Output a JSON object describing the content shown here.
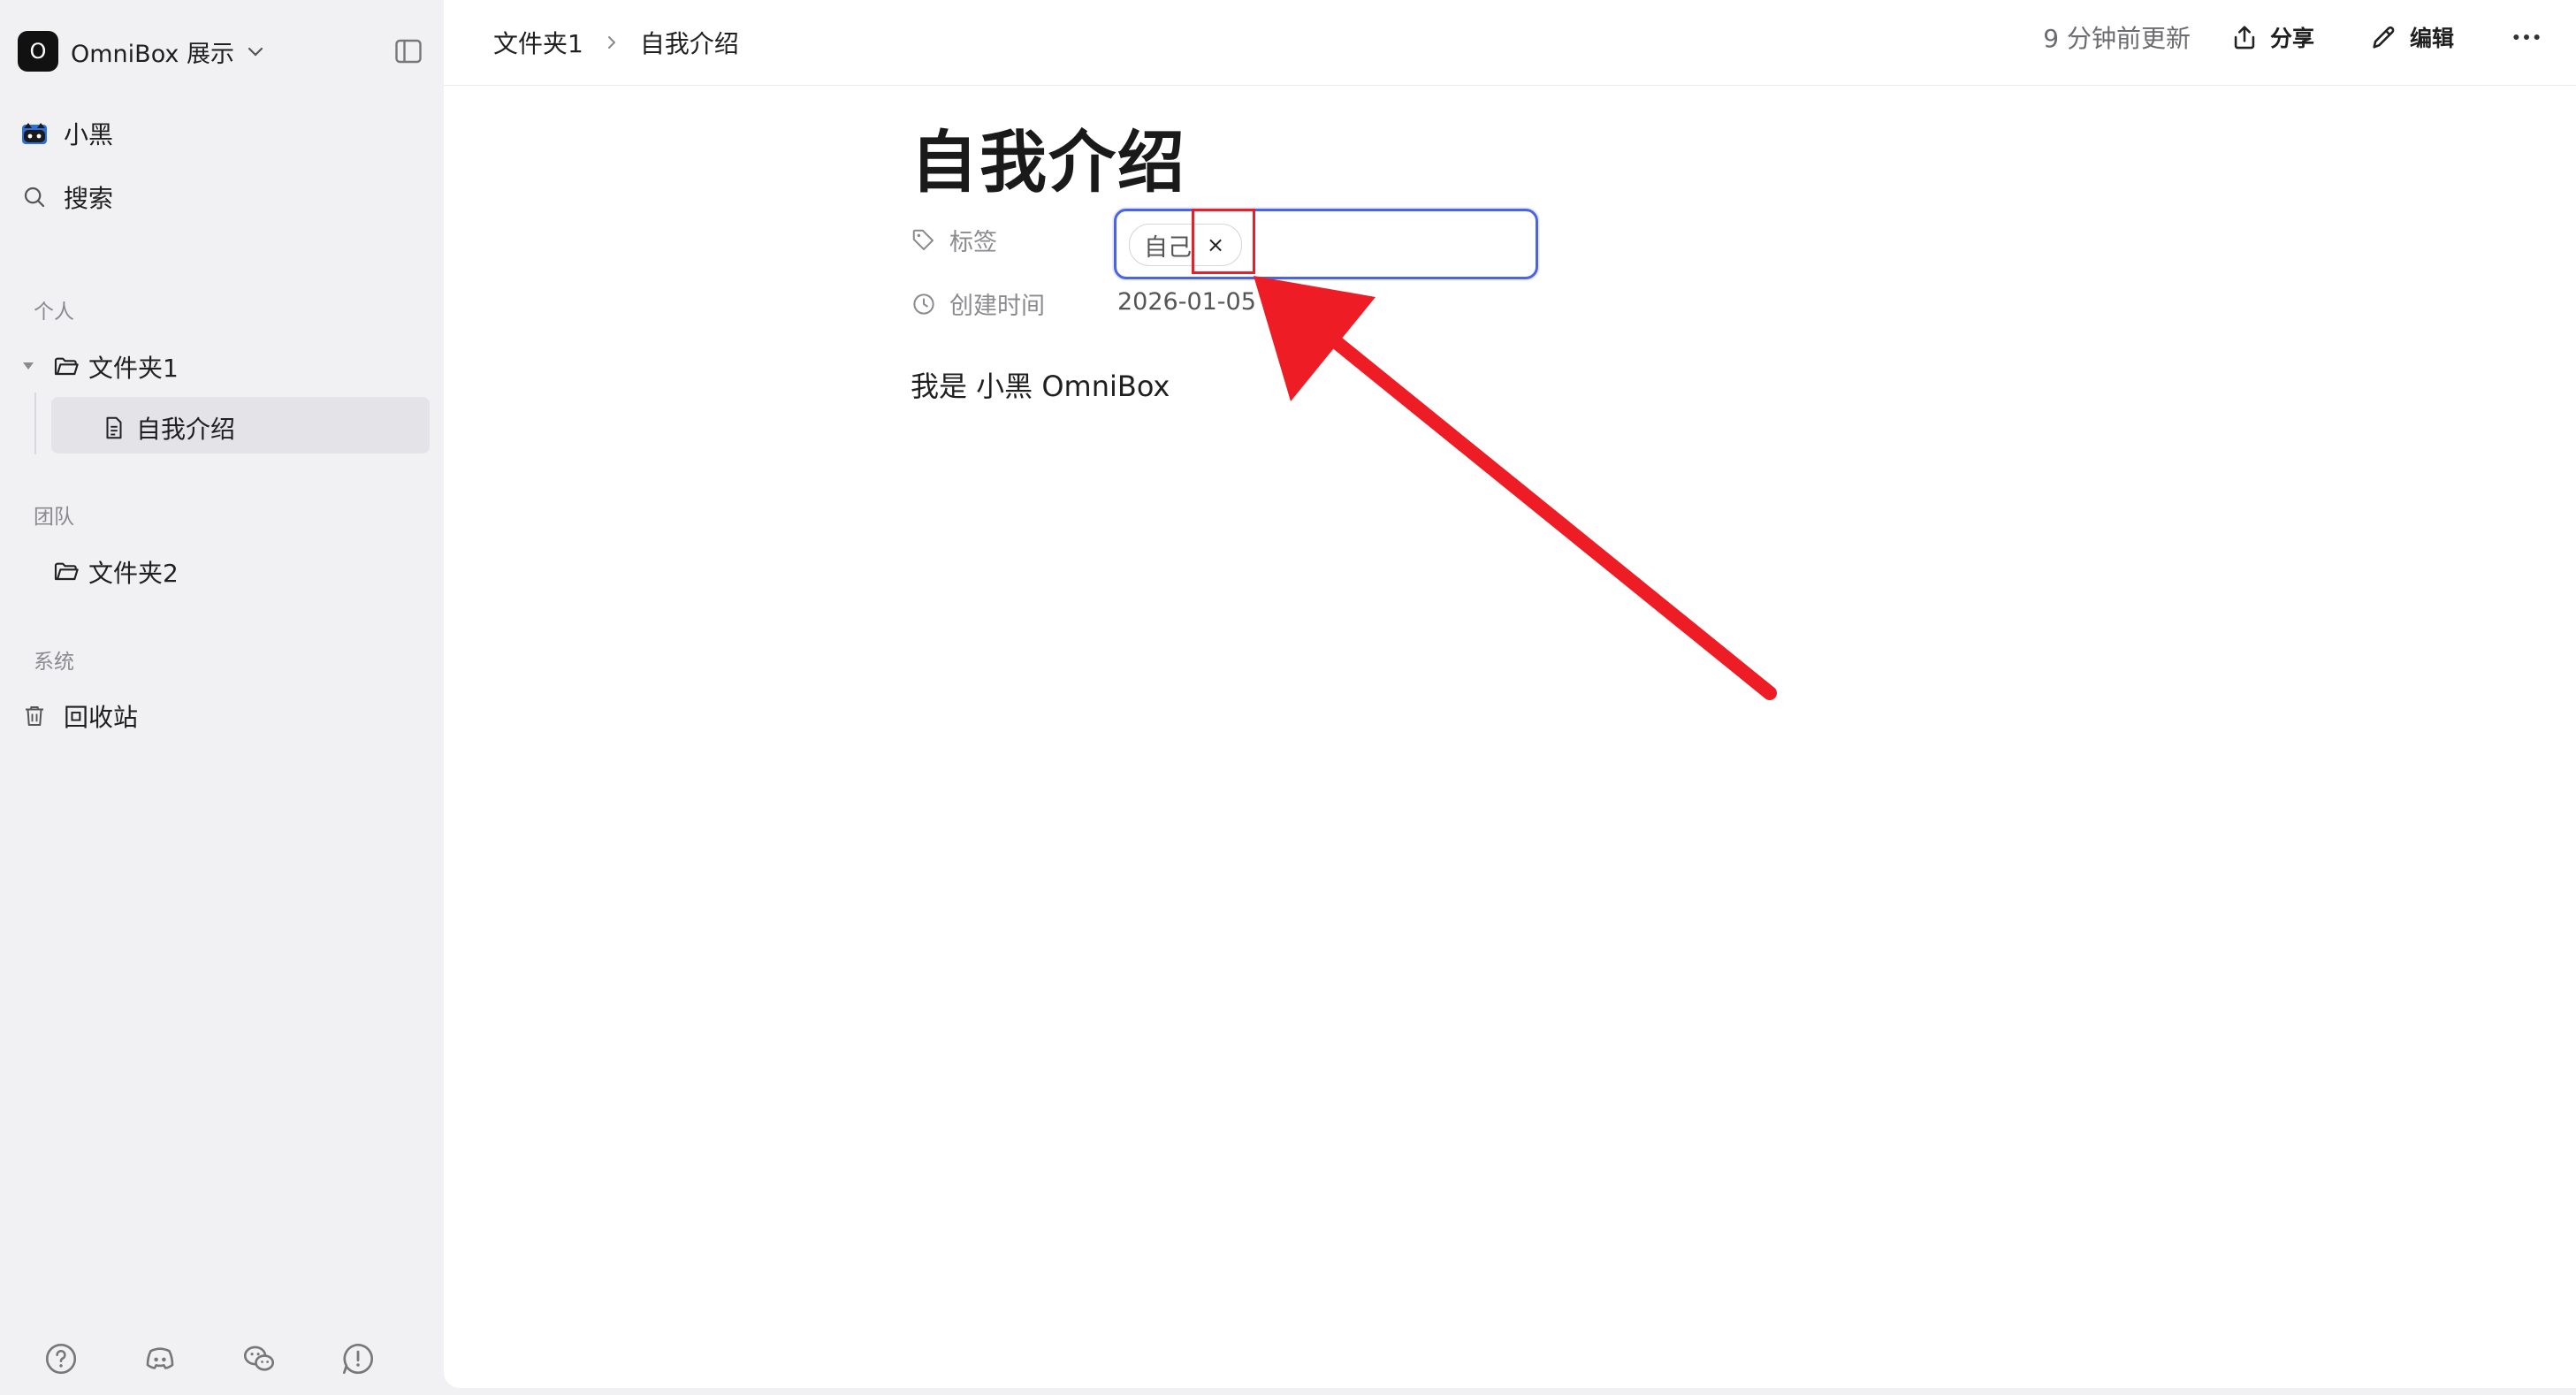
{
  "workspace": {
    "logo_letter": "O",
    "name": "OmniBox 展示"
  },
  "sidebar": {
    "user": "小黑",
    "search": "搜索",
    "personal_label": "个人",
    "folder1": "文件夹1",
    "doc_item": "自我介绍",
    "team_label": "团队",
    "folder2": "文件夹2",
    "system_label": "系统",
    "trash": "回收站"
  },
  "breadcrumb": {
    "parent": "文件夹1",
    "current": "自我介绍"
  },
  "toolbar": {
    "updated": "9 分钟前更新",
    "share": "分享",
    "edit": "编辑"
  },
  "document": {
    "title": "自我介绍",
    "tags_label": "标签",
    "tag": "自己",
    "tag_remove": "×",
    "created_label": "创建时间",
    "created_value": "2026-01-05 ··:07",
    "body": "我是 小黑 OmniBox"
  },
  "annotation": {
    "color": "#e4202a"
  },
  "colors": {
    "accent": "#4b63e6",
    "sidebar_bg": "#f1f1f4",
    "active_bg": "#e3e3e8"
  }
}
